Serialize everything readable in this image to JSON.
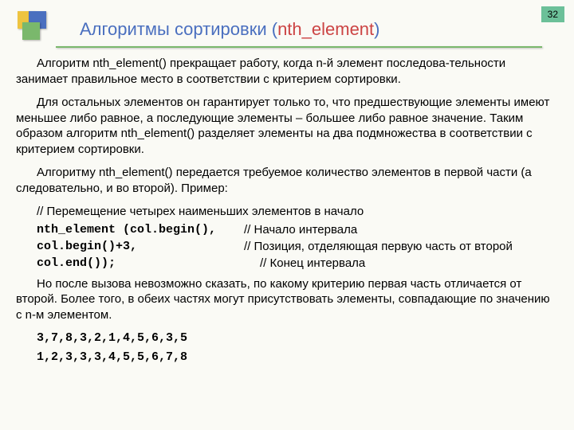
{
  "page_number": "32",
  "title": {
    "prefix": "Алгоритмы  сортировки  (",
    "em": "nth_element",
    "suffix": ")"
  },
  "paragraphs": {
    "p1": "Алгоритм nth_element() прекращает работу, когда n-й элемент последова-тельности занимает правильное место в соответствии с критерием сортировки.",
    "p2": "Для остальных элементов он гарантирует только то, что предшествующие элементы имеют меньшее либо равное, а последующие элементы – большее либо равное значение. Таким образом алгоритм nth_element() разделяет элементы на два подмножества в соответствии с критерием сортировки.",
    "p3": "Алгоритму nth_element() передается требуемое количество элементов в первой части (а следовательно, и во второй). Пример:",
    "c0": "// Перемещение четырех наименьших элементов в начало",
    "c1_code": "nth_element (col.begin(),",
    "c1_cmt": "// Начало интервала",
    "c2_code": "col.begin()+3,",
    "c2_cmt": "// Позиция, отделяющая первую часть от второй",
    "c3_code": "col.end());",
    "c3_cmt": "// Конец интервала",
    "p4": "Но после вызова невозможно сказать, по какому критерию первая часть отличается от второй. Более того, в обеих частях могут  присутствовать элементы, совпадающие по значению с n-м элементом.",
    "seq1": "3,7,8,3,2,1,4,5,6,3,5",
    "seq2": "1,2,3,3,3,4,5,5,6,7,8"
  }
}
